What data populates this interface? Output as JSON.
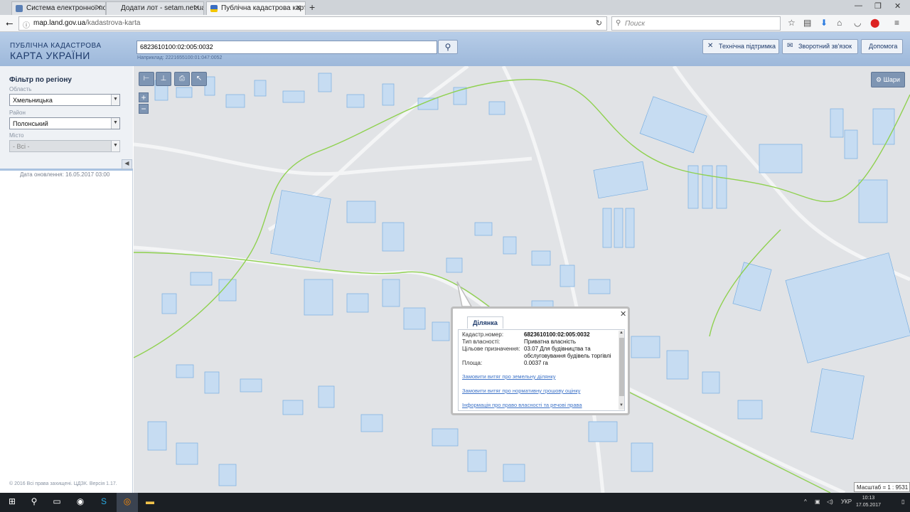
{
  "browser": {
    "tabs": [
      {
        "label": "Система електронної поштово",
        "active": false
      },
      {
        "label": "Додати лот - setam.net.ua",
        "active": false
      },
      {
        "label": "Публічна кадастрова карта",
        "active": true
      }
    ],
    "url_host": "map.land.gov.ua",
    "url_path": "/kadastrova-karta",
    "search_placeholder": "Поиск"
  },
  "header": {
    "logo_line1": "ПУБЛІЧНА КАДАСТРОВА",
    "logo_line2": "КАРТА УКРАЇНИ",
    "cadastral_input_value": "6823610100:02:005:0032",
    "example_text": "Наприклад: 2221655100:01:047:0052",
    "buttons": {
      "support": "Технічна підтримка",
      "feedback": "Зворотний зв'язок",
      "help": "Допомога"
    }
  },
  "sidebar": {
    "title": "Фільтр по регіону",
    "region_label": "Область",
    "region_value": "Хмельницька",
    "district_label": "Район",
    "district_value": "Полонський",
    "city_label": "Місто",
    "city_value": "- Всі -",
    "update_date": "Дата оновлення: 16.05.2017 03:00",
    "footer": "© 2016 Всі права захищені. ЦДЗК. Версія 1.17."
  },
  "map": {
    "layers_label": "Шари",
    "scale_text": "Масштаб = 1 : 9531",
    "colors": {
      "background": "#e1e3e6",
      "parcel_fill": "#c6dcf2",
      "parcel_stroke": "#79aee0",
      "boundary": "#8fd14f",
      "road": "#bfc3c8"
    }
  },
  "popup": {
    "tab_label": "Ділянка",
    "rows": [
      {
        "key": "Кадастр.номер:",
        "value": "6823610100:02:005:0032"
      },
      {
        "key": "Тип власності:",
        "value": "Приватна власність"
      },
      {
        "key": "Цільове призначення:",
        "value": "03.07 Для будівництва та обслуговування будівель торгівлі"
      },
      {
        "key": "Площа:",
        "value": "0.0037 га"
      }
    ],
    "links": [
      "Замовити витяг про земельну ділянку",
      "Замовити витяг про нормативну грошову оцінку",
      "Інформація про право власності та речові права"
    ]
  },
  "taskbar": {
    "language": "УКР",
    "time": "10:13",
    "date": "17.05.2017"
  }
}
